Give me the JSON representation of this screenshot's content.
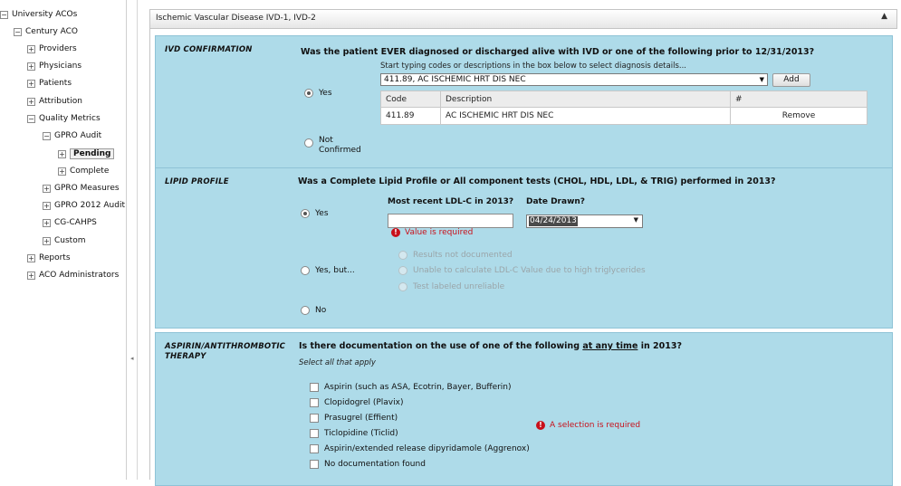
{
  "sidebar": {
    "items": [
      {
        "label": "University ACOs",
        "toggle": "−"
      },
      {
        "label": "Century ACO",
        "toggle": "−"
      },
      {
        "label": "Providers",
        "toggle": "+"
      },
      {
        "label": "Physicians",
        "toggle": "+"
      },
      {
        "label": "Patients",
        "toggle": "+"
      },
      {
        "label": "Attribution",
        "toggle": "+"
      },
      {
        "label": "Quality Metrics",
        "toggle": "−"
      },
      {
        "label": "GPRO Audit",
        "toggle": "−"
      },
      {
        "label": "Pending",
        "toggle": "+"
      },
      {
        "label": "Complete",
        "toggle": "+"
      },
      {
        "label": "GPRO Measures",
        "toggle": "+"
      },
      {
        "label": "GPRO 2012 Audit",
        "toggle": "+"
      },
      {
        "label": "CG-CAHPS",
        "toggle": "+"
      },
      {
        "label": "Custom",
        "toggle": "+"
      },
      {
        "label": "Reports",
        "toggle": "+"
      },
      {
        "label": "ACO Administrators",
        "toggle": "+"
      }
    ]
  },
  "splitter": {
    "grip": "◂"
  },
  "panel": {
    "title": "Ischemic Vascular Disease IVD-1, IVD-2",
    "collapse_icon": "▲"
  },
  "ivd": {
    "title": "IVD CONFIRMATION",
    "question": "Was the patient EVER diagnosed or discharged alive with IVD or one of the following prior to 12/31/2013?",
    "hint": "Start typing codes or descriptions in the box below to select diagnosis details...",
    "selected_value": "411.89, AC ISCHEMIC HRT DIS NEC",
    "add_label": "Add",
    "yes_label": "Yes",
    "not_confirmed_label_1": "Not",
    "not_confirmed_label_2": "Confirmed",
    "table": {
      "headers": [
        "Code",
        "Description",
        "#"
      ],
      "rows": [
        {
          "code": "411.89",
          "description": "AC ISCHEMIC HRT DIS NEC",
          "action": "Remove"
        }
      ]
    }
  },
  "lipid": {
    "title": "LIPID PROFILE",
    "question": "Was a Complete Lipid Profile or All component tests (CHOL, HDL, LDL, & TRIG) performed in 2013?",
    "ldl_label": "Most recent LDL-C in 2013?",
    "date_label": "Date Drawn?",
    "date_value": "04/24/2013",
    "error": "Value is required",
    "yes_label": "Yes",
    "yes_but_label": "Yes, but...",
    "no_label": "No",
    "sub_options": [
      "Results not documented",
      "Unable to calculate LDL-C Value due to high triglycerides",
      "Test labeled unreliable"
    ]
  },
  "aspirin": {
    "title_1": "ASPIRIN/ANTITHROMBOTIC",
    "title_2": "THERAPY",
    "question_pre": "Is there documentation on the use of one of the following",
    "question_underline": "at any time",
    "question_post": "in 2013?",
    "hint": "Select all that apply",
    "error": "A selection is required",
    "options": [
      "Aspirin (such as ASA, Ecotrin, Bayer, Bufferin)",
      "Clopidogrel (Plavix)",
      "Prasugrel (Effient)",
      "Ticlopidine (Ticlid)",
      "Aspirin/extended release dipyridamole (Aggrenox)",
      "No documentation found"
    ]
  },
  "icons": {
    "error": "!",
    "dropdown": "▼"
  }
}
